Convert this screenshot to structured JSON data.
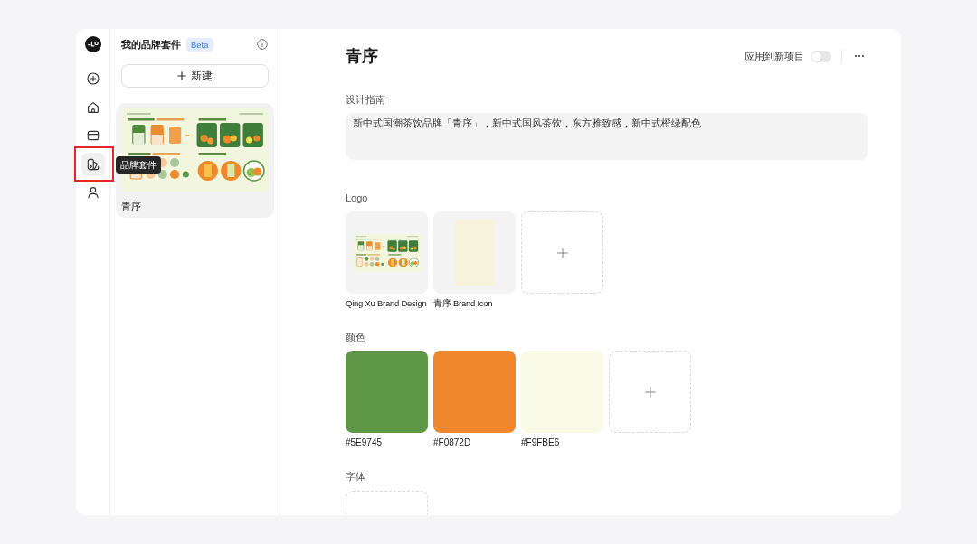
{
  "rail": {
    "items": [
      {
        "selected": false,
        "highlighted": false
      },
      {
        "selected": false,
        "highlighted": false
      },
      {
        "selected": false,
        "highlighted": false
      },
      {
        "selected": true,
        "highlighted": true
      },
      {
        "selected": false,
        "highlighted": false
      }
    ],
    "tooltip": "品牌套件"
  },
  "panel": {
    "title": "我的品牌套件",
    "badge": "Beta",
    "new_button": "新建",
    "kits": [
      {
        "name": "青序",
        "selected": true
      }
    ]
  },
  "main": {
    "title": "青序",
    "apply_toggle": {
      "label": "应用到新项目",
      "on": false
    },
    "guide": {
      "label": "设计指南",
      "value": "新中式国潮茶饮品牌「青序」，新中式国风茶饮，东方雅致感，新中式橙绿配色"
    },
    "logos": {
      "label": "Logo",
      "items": [
        {
          "kind": "board",
          "name": "Qing Xu Brand Design"
        },
        {
          "kind": "mark",
          "name": "青序 Brand Icon"
        }
      ]
    },
    "colors": {
      "label": "颜色",
      "items": [
        {
          "label": "#5E9745",
          "color": "#5e9745"
        },
        {
          "label": "#F0872D",
          "color": "#f0872d"
        },
        {
          "label": "#F9FBE6",
          "color": "#f9fbe6"
        }
      ]
    },
    "fonts": {
      "label": "字体"
    }
  }
}
